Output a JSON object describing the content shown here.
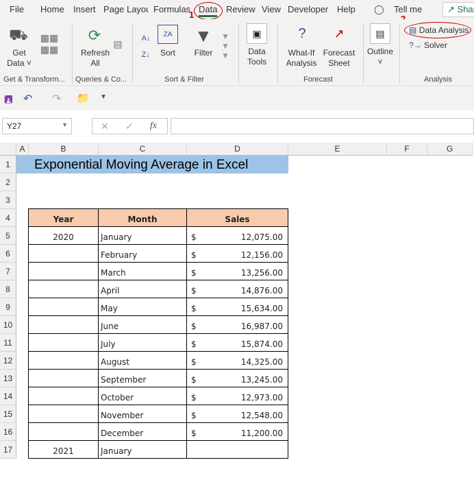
{
  "tabs": [
    "File",
    "Home",
    "Insert",
    "Page Layout",
    "Formulas",
    "Data",
    "Review",
    "View",
    "Developer",
    "Help"
  ],
  "tell_me": "Tell me",
  "share": "Share",
  "annotations": {
    "step1": "1",
    "step2": "2"
  },
  "ribbon": {
    "get_data": "Get Data",
    "refresh_all": "Refresh All",
    "sort": "Sort",
    "filter": "Filter",
    "data_tools": "Data Tools",
    "what_if": "What-If Analysis",
    "forecast_sheet": "Forecast Sheet",
    "outline": "Outline",
    "data_analysis": "Data Analysis",
    "solver": "Solver",
    "groups": [
      "Get & Transform...",
      "Queries & Co...",
      "Sort & Filter",
      "Forecast",
      "Analysis"
    ]
  },
  "name_box": "Y27",
  "formula": "",
  "columns": [
    "A",
    "B",
    "C",
    "D",
    "E",
    "F",
    "G"
  ],
  "rows": [
    "1",
    "2",
    "3",
    "4",
    "5",
    "6",
    "7",
    "8",
    "9",
    "10",
    "11",
    "12",
    "13",
    "14",
    "15",
    "16",
    "17"
  ],
  "sheet": {
    "title": "Exponential Moving Average in Excel",
    "headers": [
      "Year",
      "Month",
      "Sales"
    ],
    "data": [
      {
        "year": "2020",
        "month": "January",
        "cur": "$",
        "sales": "12,075.00"
      },
      {
        "year": "",
        "month": "February",
        "cur": "$",
        "sales": "12,156.00"
      },
      {
        "year": "",
        "month": "March",
        "cur": "$",
        "sales": "13,256.00"
      },
      {
        "year": "",
        "month": "April",
        "cur": "$",
        "sales": "14,876.00"
      },
      {
        "year": "",
        "month": "May",
        "cur": "$",
        "sales": "15,634.00"
      },
      {
        "year": "",
        "month": "June",
        "cur": "$",
        "sales": "16,987.00"
      },
      {
        "year": "",
        "month": "July",
        "cur": "$",
        "sales": "15,874.00"
      },
      {
        "year": "",
        "month": "August",
        "cur": "$",
        "sales": "14,325.00"
      },
      {
        "year": "",
        "month": "September",
        "cur": "$",
        "sales": "13,245.00"
      },
      {
        "year": "",
        "month": "October",
        "cur": "$",
        "sales": "12,973.00"
      },
      {
        "year": "",
        "month": "November",
        "cur": "$",
        "sales": "12,548.00"
      },
      {
        "year": "",
        "month": "December",
        "cur": "$",
        "sales": "11,200.00"
      },
      {
        "year": "2021",
        "month": "January",
        "cur": "",
        "sales": ""
      }
    ]
  },
  "colors": {
    "title_fill": "#9dc3e6",
    "header_fill": "#f8cbad",
    "annotation": "#c00000",
    "active_tab_underline": "#217346"
  }
}
